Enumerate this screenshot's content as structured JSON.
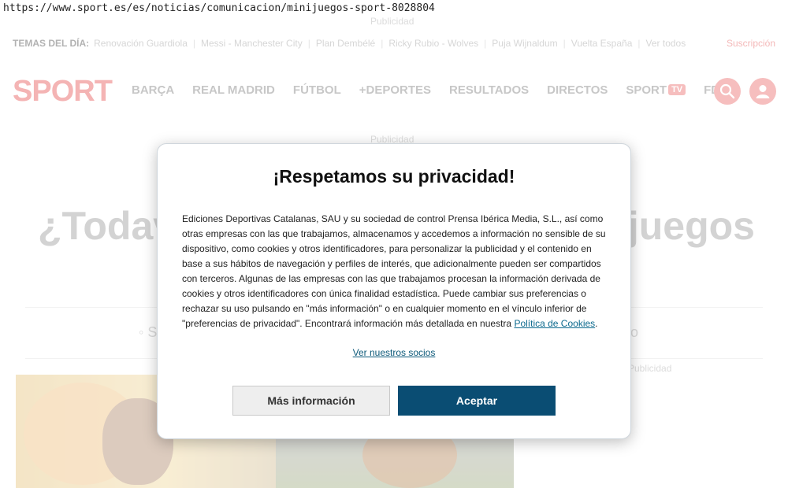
{
  "browser": {
    "url": "https://www.sport.es/es/noticias/comunicacion/minijuegos-sport-8028804"
  },
  "ads": {
    "label": "Publicidad"
  },
  "topics": {
    "lead": "TEMAS DEL DÍA:",
    "items": [
      "Renovación Guardiola",
      "Messi - Manchester City",
      "Plan Dembélé",
      "Ricky Rubio - Wolves",
      "Puja Wijnaldum",
      "Vuelta España",
      "Ver todos"
    ],
    "subscribe": "Suscripción"
  },
  "header": {
    "logo": "SPORT",
    "nav": [
      "BARÇA",
      "REAL MADRID",
      "FÚTBOL",
      "+DEPORTES",
      "RESULTADOS",
      "DIRECTOS"
    ],
    "sport_tv": {
      "label": "SPORT",
      "badge": "TV"
    },
    "fdj": "FDJ",
    "search_icon": "search-icon",
    "user_icon": "user-icon"
  },
  "article": {
    "headline_left": "¿Todav",
    "headline_right": "ijuegos",
    "byline_left": "S",
    "byline_right": "rio"
  },
  "colors": {
    "brand": "#e8262b",
    "accept": "#0a4d73"
  },
  "consent": {
    "title": "¡Respetamos su privacidad!",
    "body": "Ediciones Deportivas Catalanas, SAU y su sociedad de control Prensa Ibérica Media, S.L., así como otras empresas con las que trabajamos, almacenamos y accedemos a información no sensible de su dispositivo, como cookies y otros identificadores, para personalizar la publicidad y el contenido en base a sus hábitos de navegación y perfiles de interés, que adicionalmente pueden ser compartidos con terceros. Algunas de las empresas con las que trabajamos procesan la información derivada de cookies y otros identificadores con única finalidad estadística. Puede cambiar sus preferencias o rechazar su uso pulsando en \"más información\" o en cualquier momento en el vínculo inferior de \"preferencias de privacidad\". Encontrará información más detallada en nuestra",
    "policy_link": "Política de Cookies",
    "body_end": ".",
    "partners_link": "Ver nuestros socios",
    "more_button": "Más información",
    "accept_button": "Aceptar"
  }
}
